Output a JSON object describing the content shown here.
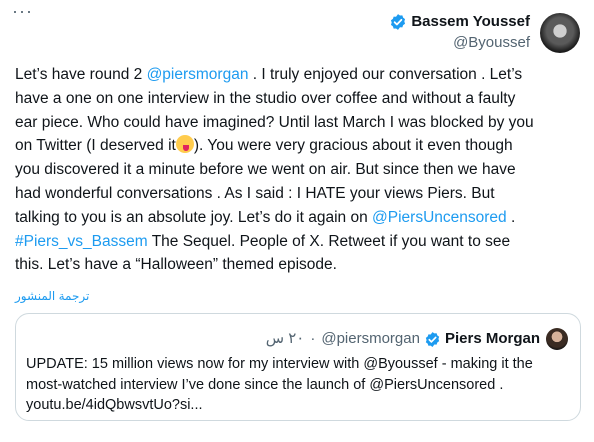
{
  "more_label": "···",
  "author": {
    "name": "Bassem Youssef",
    "handle": "@Byoussef",
    "verified_color": "#1d9bf0"
  },
  "tweet": {
    "lines": [
      [
        {
          "t": "Let’s have round 2 "
        },
        {
          "t": "@piersmorgan",
          "link": true
        },
        {
          "t": " . I truly enjoyed our conversation . Let’s"
        }
      ],
      [
        {
          "t": "have a one on one interview in the studio over coffee and without a faulty"
        }
      ],
      [
        {
          "t": "ear piece. Who could have imagined? Until last March I was blocked by you"
        }
      ],
      [
        {
          "t": "on Twitter (I deserved it"
        },
        {
          "emoji": "winking-face-with-tongue"
        },
        {
          "t": "). You were very gracious about it even though"
        }
      ],
      [
        {
          "t": "you discovered it a minute before we went on air.  But since then we have"
        }
      ],
      [
        {
          "t": "had wonderful conversations . As I said : I HATE your views Piers. But"
        }
      ],
      [
        {
          "t": "talking to you is an absolute joy. Let’s do it again on "
        },
        {
          "t": "@PiersUncensored",
          "link": true
        },
        {
          "t": " ."
        }
      ],
      [
        {
          "t": "#Piers_vs_Bassem",
          "link": true
        },
        {
          "t": " The Sequel. People of X. Retweet if you want to see"
        }
      ],
      [
        {
          "t": "this. Let’s have a “Halloween” themed episode."
        }
      ]
    ]
  },
  "translate_label": "ترجمة المنشور",
  "quote": {
    "name": "Piers Morgan",
    "handle": "@piersmorgan",
    "time": "٢٠ س",
    "separator": "·",
    "lines": [
      "UPDATE: 15 million views now for my interview with @Byoussef - making it the",
      "most-watched interview I’ve done since the launch of @PiersUncensored .",
      "youtu.be/4idQbwsvtUo?si..."
    ]
  },
  "colors": {
    "accent": "#1d9bf0",
    "text": "#0f1419",
    "muted": "#536471",
    "border": "#cfd9de"
  }
}
